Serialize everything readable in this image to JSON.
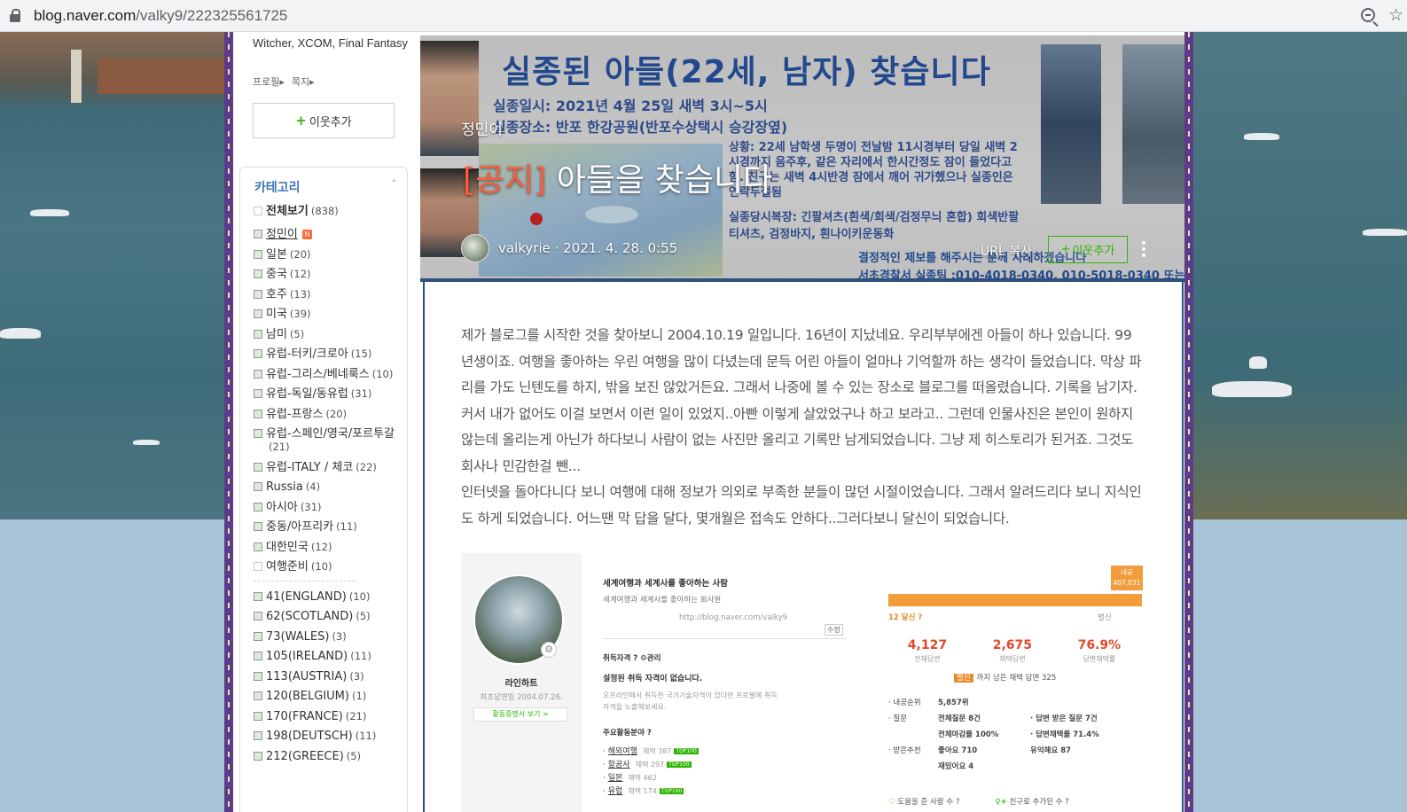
{
  "browser": {
    "url_host": "blog.naver.com",
    "url_path": "/valky9/222325561725"
  },
  "sidebar": {
    "profile_text": "Witcher, XCOM, Final Fantasy",
    "profile_link": "프로필▸",
    "message_link": "쪽지▸",
    "add_neighbor": "이웃추가",
    "category_title": "카테고리",
    "all_view": {
      "label": "전체보기",
      "count": "(838)"
    },
    "categories": [
      {
        "label": "정민이",
        "count": "",
        "badge": "N",
        "underline": true
      },
      {
        "label": "일본",
        "count": "(20)"
      },
      {
        "label": "중국",
        "count": "(12)"
      },
      {
        "label": "호주",
        "count": "(13)"
      },
      {
        "label": "미국",
        "count": "(39)"
      },
      {
        "label": "남미",
        "count": "(5)"
      },
      {
        "label": "유럽-터키/크로아",
        "count": "(15)"
      },
      {
        "label": "유럽-그리스/베네룩스",
        "count": "(10)"
      },
      {
        "label": "유럽-독일/동유럽",
        "count": "(31)"
      },
      {
        "label": "유럽-프랑스",
        "count": "(20)"
      },
      {
        "label": "유럽-스페인/영국/포르투갈",
        "count": "(21)"
      },
      {
        "label": "유럽-ITALY / 체코",
        "count": "(22)"
      },
      {
        "label": "Russia",
        "count": "(4)"
      },
      {
        "label": "아시아",
        "count": "(31)"
      },
      {
        "label": "중동/아프리카",
        "count": "(11)"
      },
      {
        "label": "대한민국",
        "count": "(12)"
      },
      {
        "label": "여행준비",
        "count": "(10)",
        "plain": true
      }
    ],
    "categories2": [
      {
        "label": "41(ENGLAND)",
        "count": "(10)"
      },
      {
        "label": "62(SCOTLAND)",
        "count": "(5)"
      },
      {
        "label": "73(WALES)",
        "count": "(3)"
      },
      {
        "label": "105(IRELAND)",
        "count": "(11)"
      },
      {
        "label": "113(AUSTRIA)",
        "count": "(3)"
      },
      {
        "label": "120(BELGIUM)",
        "count": "(1)"
      },
      {
        "label": "170(FRANCE)",
        "count": "(21)"
      },
      {
        "label": "198(DEUTSCH)",
        "count": "(11)"
      },
      {
        "label": "212(GREECE)",
        "count": "(5)"
      }
    ]
  },
  "banner": {
    "title": "실종된 아들(22세, 남자) 찾습니다",
    "line1": "실종일시: 2021년 4월 25일 새벽 3시~5시",
    "line2": "실종장소: 반포 한강공원(반포수상택시 승강장옆)",
    "status": "상황: 22세 남학생 두명이 전날밤 11시경부터 당일 새벽 2시경까지 음주후, 같은 자리에서 한시간정도 잠이 들었다고 함. 친구는 새벽 4시반경 잠에서 깨어 귀가했으나 실종인은 연락두절됨",
    "clothes": "실종당시복장: 긴팔셔츠(흰색/회색/검정무늬 혼합) 회색반팔티셔츠, 검정바지, 흰나이키운동화",
    "contact1": "결정적인 제보를 해주시는 분께 사례하겠습니다",
    "contact2": "서초경찰서 실종팀 :010-4018-0340, 010-5018-0340 또는 1"
  },
  "post": {
    "category": "정민이",
    "title_tag": "[공지]",
    "title": "아들을 찾습니다",
    "byline": "valkyrie · 2021. 4. 28. 0:55",
    "url_copy": "URL 복사",
    "neighbor_add": "이웃추가",
    "paragraphs": [
      "제가 블로그를 시작한 것을 찾아보니 2004.10.19 일입니다. 16년이 지났네요. 우리부부에겐 아들이 하나 있습니다. 99년생이죠. 여행을 좋아하는 우린 여행을 많이 다녔는데 문득 어린 아들이 얼마나 기억할까 하는 생각이 들었습니다. 막상 파리를 가도 닌텐도를 하지, 밖을 보진 않았거든요. 그래서 나중에 볼 수 있는 장소로 블로그를 떠올렸습니다. 기록을 남기자. 커서 내가 없어도 이걸 보면서 이런 일이 있었지..아빤 이렇게 살았었구나 하고 보라고.. 그런데 인물사진은 본인이 원하지 않는데 올리는게 아닌가 하다보니 사람이 없는 사진만 올리고 기록만 남게되었습니다. 그냥 제 히스토리가 된거죠. 그것도 회사나 민감한걸 뺀...",
      "인터넷을 돌아다니다 보니 여행에 대해 정보가 의외로 부족한 분들이 많던 시절이었습니다. 그래서 알려드리다 보니 지식인도 하게 되었습니다. 어느땐 막 답을 달다, 몇개월은 접속도 안하다..그러다보니 달신이 되었습니다."
    ]
  },
  "kin": {
    "name": "라인하트",
    "date": "최초답변일 2004.07.26.",
    "cert_btn": "활동증명서 보기 >",
    "headline": "세계여행과 세계사를 좋아하는 사람",
    "sub": "세계여행과 세계사를 좋아하는 회사원",
    "url": "http://blog.naver.com/valky9",
    "edit": "수정",
    "qual_title": "취득자격 ? ⚙관리",
    "qual_none": "설정된 취득 자격이 없습니다.",
    "qual_note": "오프라인에서 취득한 국가기술자격이 있다면 프로필에 취득 자격을 노출해보세요.",
    "areas_title": "주요활동분야 ?",
    "areas": [
      {
        "name": "해외여행",
        "num": "채택 387",
        "top": "TOP100"
      },
      {
        "name": "항공사",
        "num": "채택 297",
        "top": "TOP100"
      },
      {
        "name": "일본",
        "num": "채택 462",
        "top": ""
      },
      {
        "name": "유럽",
        "num": "채택 174",
        "top": "TOP100"
      }
    ],
    "bar_badge": "내공 407,031",
    "rank": "12 달신 ?",
    "rank_right": "별신",
    "stats": [
      {
        "value": "4,127",
        "label": "전체답변"
      },
      {
        "value": "2,675",
        "label": "채택답변"
      },
      {
        "value": "76.9%",
        "label": "답변채택률"
      }
    ],
    "remain_tag": "별신",
    "remain_text": "까지 남은 채택 답변 325",
    "details": [
      {
        "k": "· 내공순위",
        "a": "5,857위",
        "b": ""
      },
      {
        "k": "· 질문",
        "a": "전체질문 8건",
        "b": "· 답변 받은 질문 7건"
      },
      {
        "k": "",
        "a": "전체마감률 100%",
        "b": "· 답변채택률 71.4%"
      },
      {
        "k": "· 받은추천",
        "a": "좋아요 710",
        "b": "유익해요 87"
      },
      {
        "k": "",
        "a": "재밌어요 4",
        "b": ""
      }
    ],
    "footer_left": "도움을 준 사람 수 ?",
    "footer_right": "친구로 추가된 수 ?"
  },
  "colors": {
    "frame": "#5c3b8a",
    "accent_green": "#2db400",
    "category_blue": "#3a73b8",
    "tag_red": "#ff5a3d"
  }
}
